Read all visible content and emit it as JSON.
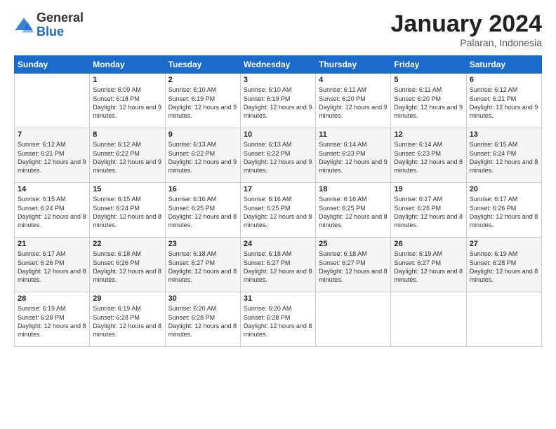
{
  "header": {
    "logo_general": "General",
    "logo_blue": "Blue",
    "month_title": "January 2024",
    "location": "Palaran, Indonesia"
  },
  "days_of_week": [
    "Sunday",
    "Monday",
    "Tuesday",
    "Wednesday",
    "Thursday",
    "Friday",
    "Saturday"
  ],
  "weeks": [
    [
      {
        "num": "",
        "sunrise": "",
        "sunset": "",
        "daylight": ""
      },
      {
        "num": "1",
        "sunrise": "6:09 AM",
        "sunset": "6:18 PM",
        "daylight": "12 hours and 9 minutes."
      },
      {
        "num": "2",
        "sunrise": "6:10 AM",
        "sunset": "6:19 PM",
        "daylight": "12 hours and 9 minutes."
      },
      {
        "num": "3",
        "sunrise": "6:10 AM",
        "sunset": "6:19 PM",
        "daylight": "12 hours and 9 minutes."
      },
      {
        "num": "4",
        "sunrise": "6:11 AM",
        "sunset": "6:20 PM",
        "daylight": "12 hours and 9 minutes."
      },
      {
        "num": "5",
        "sunrise": "6:11 AM",
        "sunset": "6:20 PM",
        "daylight": "12 hours and 9 minutes."
      },
      {
        "num": "6",
        "sunrise": "6:12 AM",
        "sunset": "6:21 PM",
        "daylight": "12 hours and 9 minutes."
      }
    ],
    [
      {
        "num": "7",
        "sunrise": "6:12 AM",
        "sunset": "6:21 PM",
        "daylight": "12 hours and 9 minutes."
      },
      {
        "num": "8",
        "sunrise": "6:12 AM",
        "sunset": "6:22 PM",
        "daylight": "12 hours and 9 minutes."
      },
      {
        "num": "9",
        "sunrise": "6:13 AM",
        "sunset": "6:22 PM",
        "daylight": "12 hours and 9 minutes."
      },
      {
        "num": "10",
        "sunrise": "6:13 AM",
        "sunset": "6:22 PM",
        "daylight": "12 hours and 9 minutes."
      },
      {
        "num": "11",
        "sunrise": "6:14 AM",
        "sunset": "6:23 PM",
        "daylight": "12 hours and 9 minutes."
      },
      {
        "num": "12",
        "sunrise": "6:14 AM",
        "sunset": "6:23 PM",
        "daylight": "12 hours and 8 minutes."
      },
      {
        "num": "13",
        "sunrise": "6:15 AM",
        "sunset": "6:24 PM",
        "daylight": "12 hours and 8 minutes."
      }
    ],
    [
      {
        "num": "14",
        "sunrise": "6:15 AM",
        "sunset": "6:24 PM",
        "daylight": "12 hours and 8 minutes."
      },
      {
        "num": "15",
        "sunrise": "6:15 AM",
        "sunset": "6:24 PM",
        "daylight": "12 hours and 8 minutes."
      },
      {
        "num": "16",
        "sunrise": "6:16 AM",
        "sunset": "6:25 PM",
        "daylight": "12 hours and 8 minutes."
      },
      {
        "num": "17",
        "sunrise": "6:16 AM",
        "sunset": "6:25 PM",
        "daylight": "12 hours and 8 minutes."
      },
      {
        "num": "18",
        "sunrise": "6:16 AM",
        "sunset": "6:25 PM",
        "daylight": "12 hours and 8 minutes."
      },
      {
        "num": "19",
        "sunrise": "6:17 AM",
        "sunset": "6:26 PM",
        "daylight": "12 hours and 8 minutes."
      },
      {
        "num": "20",
        "sunrise": "6:17 AM",
        "sunset": "6:26 PM",
        "daylight": "12 hours and 8 minutes."
      }
    ],
    [
      {
        "num": "21",
        "sunrise": "6:17 AM",
        "sunset": "6:26 PM",
        "daylight": "12 hours and 8 minutes."
      },
      {
        "num": "22",
        "sunrise": "6:18 AM",
        "sunset": "6:26 PM",
        "daylight": "12 hours and 8 minutes."
      },
      {
        "num": "23",
        "sunrise": "6:18 AM",
        "sunset": "6:27 PM",
        "daylight": "12 hours and 8 minutes."
      },
      {
        "num": "24",
        "sunrise": "6:18 AM",
        "sunset": "6:27 PM",
        "daylight": "12 hours and 8 minutes."
      },
      {
        "num": "25",
        "sunrise": "6:18 AM",
        "sunset": "6:27 PM",
        "daylight": "12 hours and 8 minutes."
      },
      {
        "num": "26",
        "sunrise": "6:19 AM",
        "sunset": "6:27 PM",
        "daylight": "12 hours and 8 minutes."
      },
      {
        "num": "27",
        "sunrise": "6:19 AM",
        "sunset": "6:28 PM",
        "daylight": "12 hours and 8 minutes."
      }
    ],
    [
      {
        "num": "28",
        "sunrise": "6:19 AM",
        "sunset": "6:28 PM",
        "daylight": "12 hours and 8 minutes."
      },
      {
        "num": "29",
        "sunrise": "6:19 AM",
        "sunset": "6:28 PM",
        "daylight": "12 hours and 8 minutes."
      },
      {
        "num": "30",
        "sunrise": "6:20 AM",
        "sunset": "6:28 PM",
        "daylight": "12 hours and 8 minutes."
      },
      {
        "num": "31",
        "sunrise": "6:20 AM",
        "sunset": "6:28 PM",
        "daylight": "12 hours and 8 minutes."
      },
      {
        "num": "",
        "sunrise": "",
        "sunset": "",
        "daylight": ""
      },
      {
        "num": "",
        "sunrise": "",
        "sunset": "",
        "daylight": ""
      },
      {
        "num": "",
        "sunrise": "",
        "sunset": "",
        "daylight": ""
      }
    ]
  ],
  "labels": {
    "sunrise_prefix": "Sunrise: ",
    "sunset_prefix": "Sunset: ",
    "daylight_prefix": "Daylight: "
  }
}
